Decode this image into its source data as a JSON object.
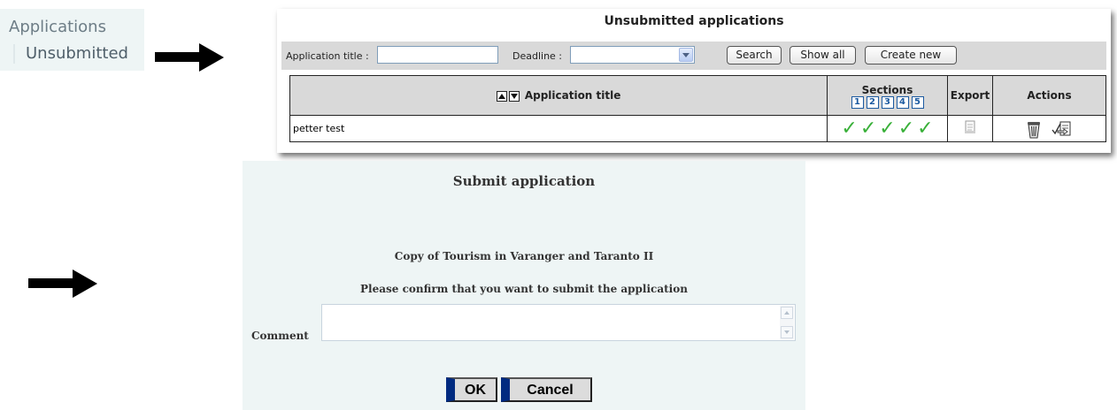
{
  "nav": {
    "title": "Applications",
    "sub_item": "Unsubmitted"
  },
  "panel": {
    "title": "Unsubmitted applications",
    "filter": {
      "title_label": "Application title :",
      "title_value": "",
      "deadline_label": "Deadline :",
      "deadline_value": "",
      "search_label": "Search",
      "show_all_label": "Show all",
      "create_new_label": "Create new"
    },
    "table": {
      "col_title": "Application title",
      "col_sections": "Sections",
      "section_numbers": [
        "1",
        "2",
        "3",
        "4",
        "5"
      ],
      "col_export": "Export",
      "col_actions": "Actions",
      "rows": [
        {
          "title": "petter test",
          "sections_complete": [
            true,
            true,
            true,
            true,
            true
          ]
        }
      ]
    },
    "check_color": "#39b039"
  },
  "dialog": {
    "title": "Submit application",
    "application_name": "Copy of Tourism in Varanger and Taranto II",
    "confirm_text": "Please confirm that you want to submit the application",
    "comment_label": "Comment",
    "comment_value": "",
    "ok_label": "OK",
    "cancel_label": "Cancel",
    "accent_color": "#002a80"
  }
}
